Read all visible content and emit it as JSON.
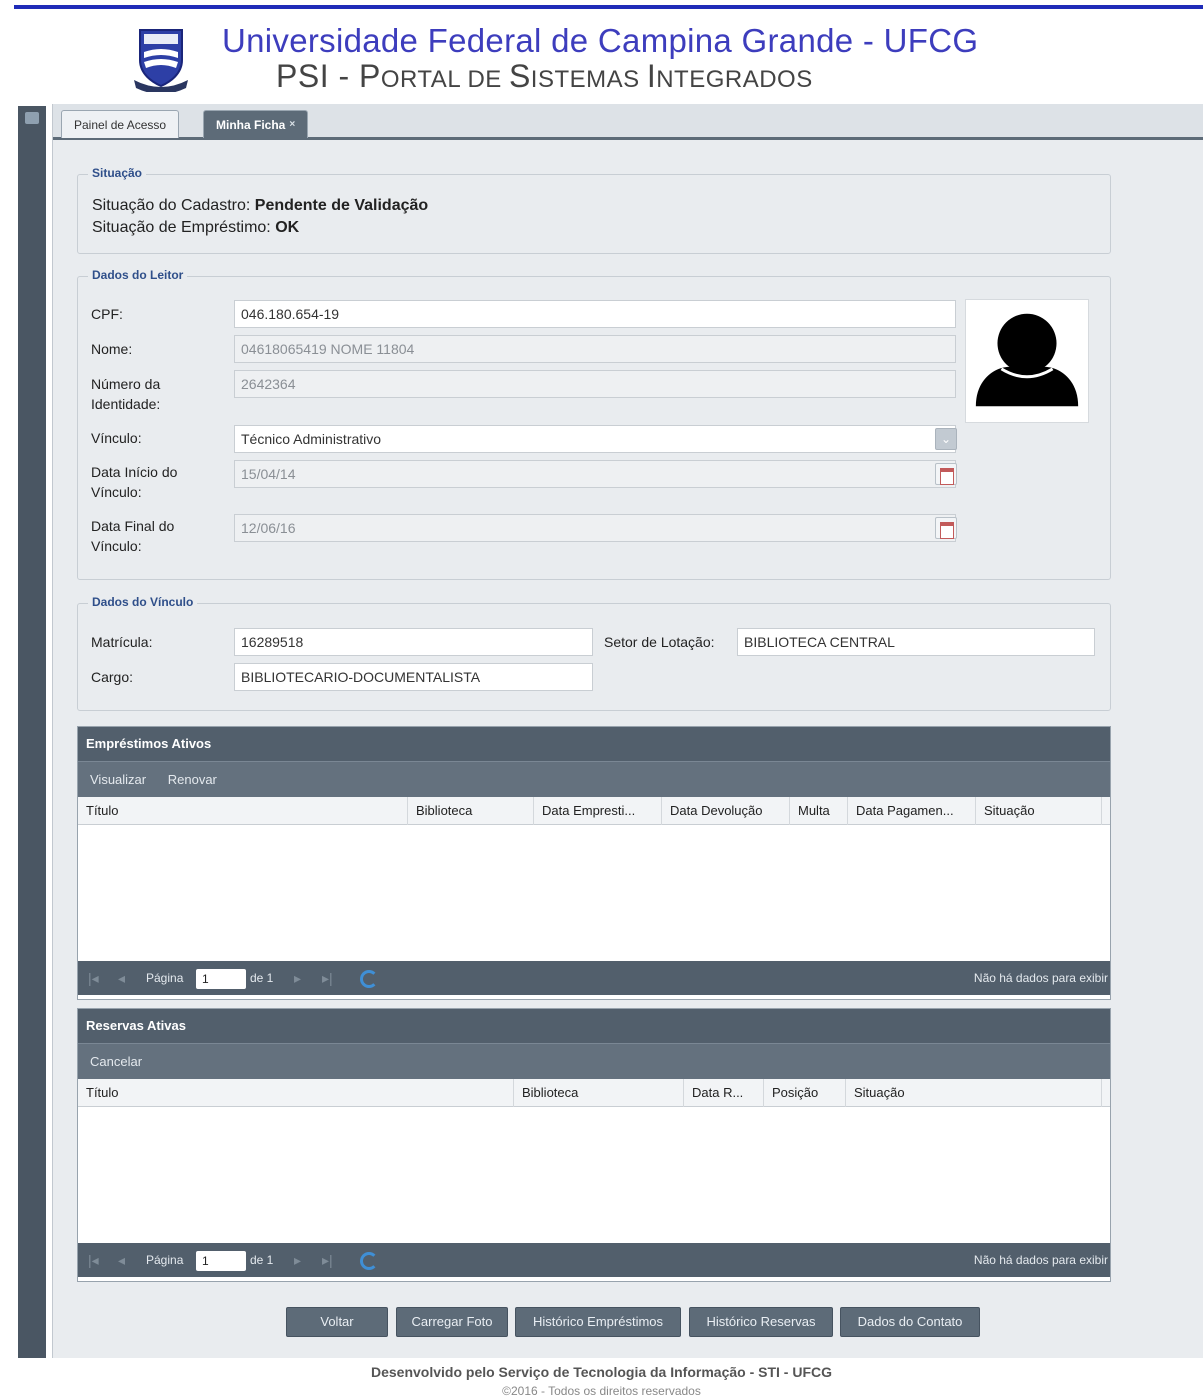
{
  "header": {
    "university": "Universidade Federal de Campina Grande - UFCG",
    "portal_first": "PSI - P",
    "portal_rest": "ORTAL DE ",
    "portal_s": "S",
    "portal_ist": "ISTEMAS ",
    "portal_i": "I",
    "portal_nt": "NTEGRADOS",
    "logo_text": "UFCG"
  },
  "tabs": {
    "painel": "Painel de Acesso",
    "ficha": "Minha Ficha",
    "close": "×"
  },
  "situacao": {
    "legend": "Situação",
    "cadastro_label": "Situação do Cadastro: ",
    "cadastro_value": "Pendente de Validação",
    "emprestimo_label": "Situação de Empréstimo: ",
    "emprestimo_value": "OK"
  },
  "leitor": {
    "legend": "Dados do Leitor",
    "cpf_label": "CPF:",
    "cpf_value": "046.180.654-19",
    "nome_label": "Nome:",
    "nome_value": "04618065419 NOME 11804",
    "identidade_label": "Número da Identidade:",
    "identidade_value": "2642364",
    "vinculo_label": "Vínculo:",
    "vinculo_value": "Técnico Administrativo",
    "inicio_label": "Data Início do Vínculo:",
    "inicio_value": "15/04/14",
    "final_label": "Data Final do Vínculo:",
    "final_value": "12/06/16"
  },
  "vinculo": {
    "legend": "Dados do Vínculo",
    "matricula_label": "Matrícula:",
    "matricula_value": "16289518",
    "setor_label": "Setor de Lotação:",
    "setor_value": "BIBLIOTECA CENTRAL",
    "cargo_label": "Cargo:",
    "cargo_value": "BIBLIOTECARIO-DOCUMENTALISTA"
  },
  "emprestimos": {
    "title": "Empréstimos Ativos",
    "toolbar": [
      "Visualizar",
      "Renovar"
    ],
    "columns": [
      "Título",
      "Biblioteca",
      "Data Empresti...",
      "Data Devolução",
      "Multa",
      "Data Pagamen...",
      "Situação"
    ],
    "pager": {
      "pagina": "Página",
      "page": "1",
      "de": "de 1",
      "msg": "Não há dados para exibir"
    }
  },
  "reservas": {
    "title": "Reservas Ativas",
    "toolbar": [
      "Cancelar"
    ],
    "columns": [
      "Título",
      "Biblioteca",
      "Data R...",
      "Posição",
      "Situação"
    ],
    "pager": {
      "pagina": "Página",
      "page": "1",
      "de": "de 1",
      "msg": "Não há dados para exibir"
    }
  },
  "buttons": {
    "voltar": "Voltar",
    "carregar_foto": "Carregar Foto",
    "hist_emprestimos": "Histórico Empréstimos",
    "hist_reservas": "Histórico Reservas",
    "dados_contato": "Dados do Contato"
  },
  "footer": {
    "line1": "Desenvolvido pelo Serviço de Tecnologia da Informação - STI - UFCG",
    "line2": "©2016 - Todos os direitos reservados"
  },
  "colors": {
    "accent_blue": "#1f2bb8",
    "title_blue": "#3d3dbd",
    "panel_dark": "#525f6c",
    "legend_blue": "#2f4f8a"
  }
}
